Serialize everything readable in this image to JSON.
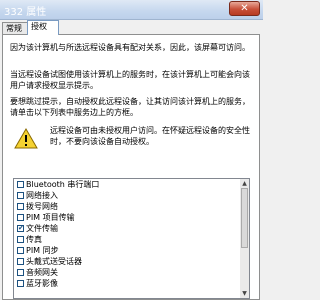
{
  "window": {
    "title": "332 属性",
    "close_label": "✕"
  },
  "tabs": [
    {
      "label": "常规",
      "active": false
    },
    {
      "label": "授权",
      "active": true
    }
  ],
  "description": {
    "p1": "因为该计算机与所选远程设备具有配对关系，因此，该屏幕可访问。",
    "p2": "当远程设备试图使用该计算机上的服务时，在该计算机上可能会向该用户请求授权显示提示。",
    "p3": "要想跳过提示，自动授权此远程设备，让其访问该计算机上的服务，请单击以下列表中服务边上的方框。"
  },
  "warning": {
    "icon": "warning-icon",
    "text": "远程设备可由未授权用户访问。在怀疑远程设备的安全性时，不要向该设备自动授权。"
  },
  "services": [
    {
      "label": "Bluetooth 串行端口",
      "checked": false
    },
    {
      "label": "网络接入",
      "checked": false
    },
    {
      "label": "拨号网络",
      "checked": false
    },
    {
      "label": "PIM 项目传输",
      "checked": false
    },
    {
      "label": "文件传输",
      "checked": true
    },
    {
      "label": "传真",
      "checked": false
    },
    {
      "label": "PIM 同步",
      "checked": false
    },
    {
      "label": "头戴式送受话器",
      "checked": false
    },
    {
      "label": "音频网关",
      "checked": false
    },
    {
      "label": "蓝牙影像",
      "checked": false
    }
  ],
  "colors": {
    "warning_fill": "#f5d232",
    "accent": "#1c5180"
  }
}
